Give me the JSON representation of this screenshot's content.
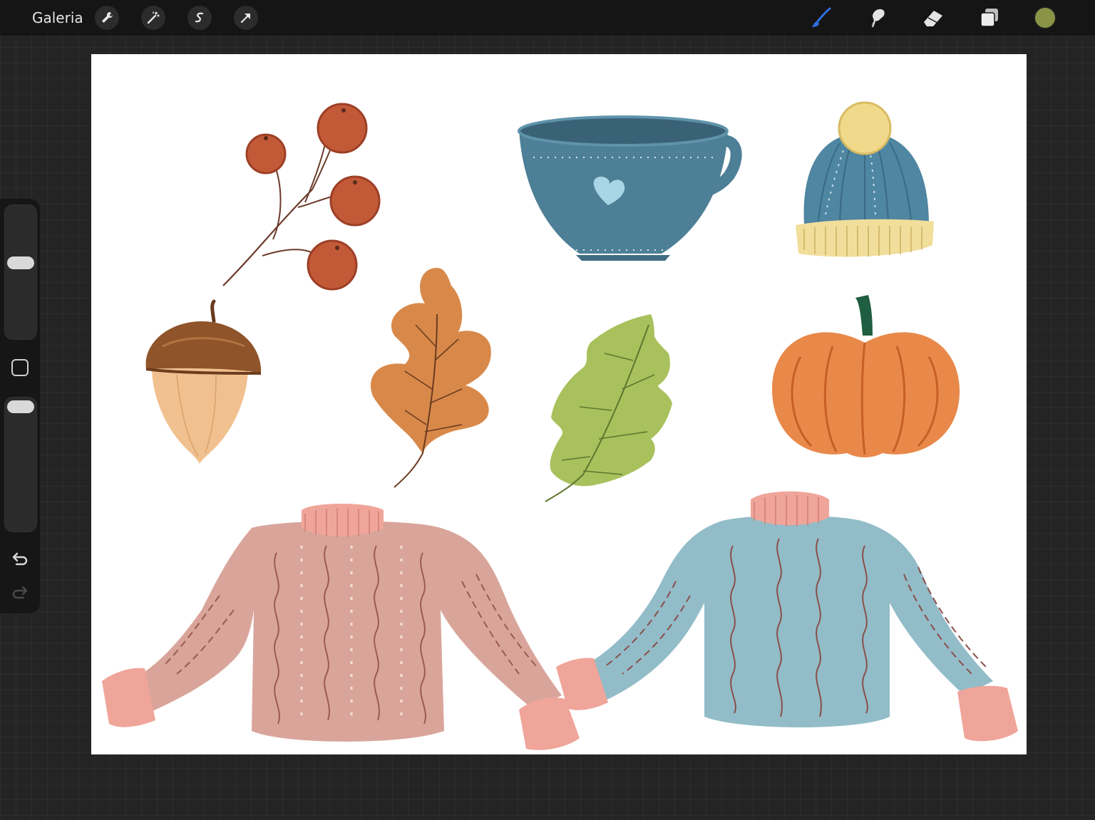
{
  "topbar": {
    "gallery_label": "Galeria",
    "left_tools": [
      "wrench-icon",
      "magic-wand-icon",
      "selection-icon",
      "transform-arrow-icon"
    ],
    "right_tools": [
      "brush-icon",
      "smudge-icon",
      "eraser-icon",
      "layers-icon"
    ],
    "active_tool": "brush-icon",
    "current_color": "#8a9446",
    "active_tool_color": "#2f6fe0"
  },
  "sidebar": {
    "brush_size_slider": "size-slider",
    "opacity_slider": "opacity-slider",
    "buttons": [
      "modify-button",
      "undo-icon",
      "redo-icon"
    ]
  },
  "canvas": {
    "background": "#ffffff",
    "objects": [
      "rowan-berries-branch",
      "blue-teacup",
      "knit-beanie",
      "acorn",
      "oak-leaf",
      "green-leaf",
      "pumpkin",
      "pink-sweater",
      "blue-sweater"
    ]
  }
}
